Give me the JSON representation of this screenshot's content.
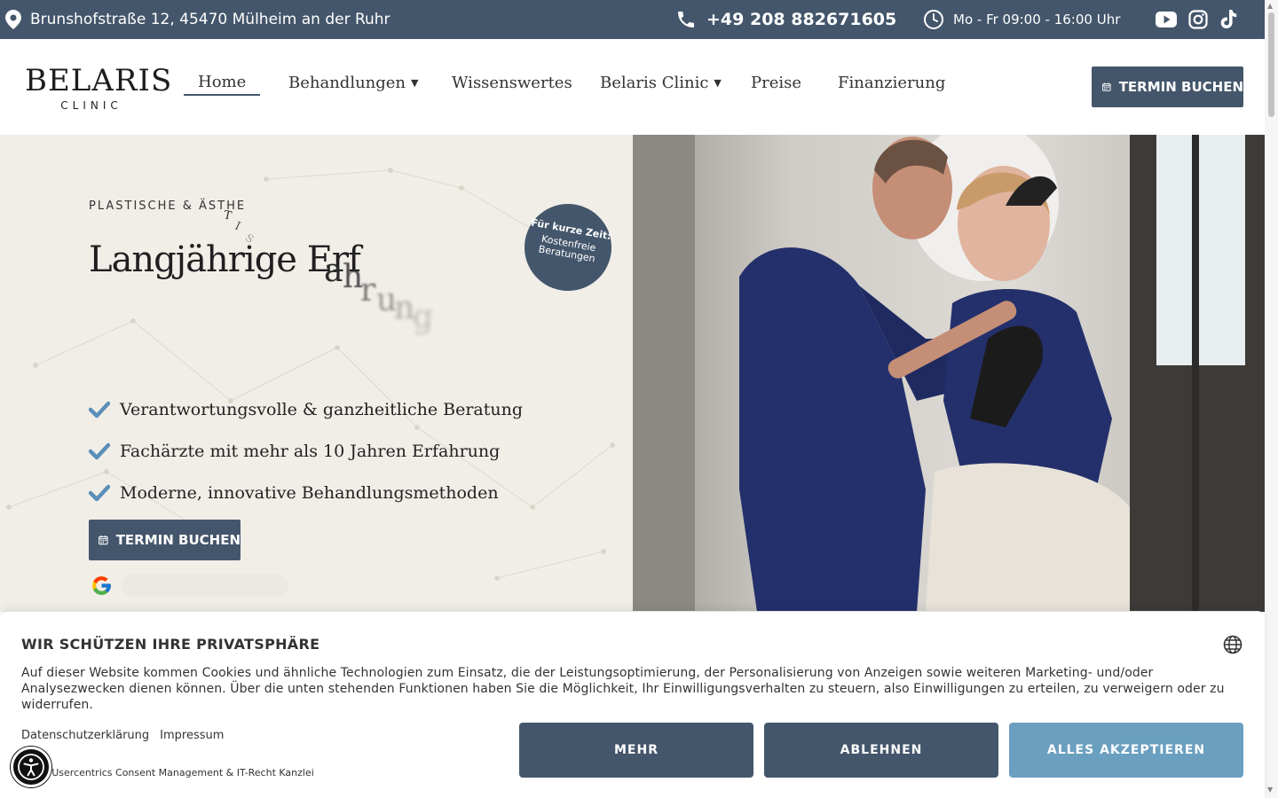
{
  "topbar": {
    "address": "Brunshofstraße 12, 45470 Mülheim an der Ruhr",
    "phone": "+49 208 882671605",
    "hours": "Mo - Fr 09:00 - 16:00 Uhr",
    "social_icons": [
      "youtube-icon",
      "instagram-icon",
      "tiktok-icon"
    ]
  },
  "logo": {
    "line1": "BELARIS",
    "line2": "CLINIC"
  },
  "nav": {
    "items": [
      {
        "label": "Home",
        "active": true
      },
      {
        "label": "Behandlungen",
        "dropdown": true
      },
      {
        "label": "Wissenswertes"
      },
      {
        "label": "Belaris Clinic",
        "dropdown": true
      },
      {
        "label": "Preise"
      },
      {
        "label": "Finanzierung"
      }
    ],
    "cta": "TERMIN BUCHEN"
  },
  "hero": {
    "eyebrow": "PLASTISCHE & ÄSTHE",
    "eyebrow_scatter": [
      "T",
      "I",
      "S"
    ],
    "headline": "Langjährige Erf",
    "headline_scatter": [
      "a",
      "h",
      "r",
      "u",
      "n",
      "g"
    ],
    "badge_line1": "Für kurze Zeit:",
    "badge_line2": "Kostenfreie Beratungen",
    "checks": [
      "Verantwortungsvolle & ganzheitliche Beratung",
      "Fachärzte mit mehr als 10 Jahren Erfahrung",
      "Moderne, innovative Behandlungsmethoden"
    ],
    "cta": "TERMIN BUCHEN",
    "review_icon": "google-icon"
  },
  "consent": {
    "title": "WIR SCHÜTZEN IHRE PRIVATSPHÄRE",
    "text": "Auf dieser Website kommen Cookies und ähnliche Technologien zum Einsatz, die der Leistungsoptimierung, der Personalisierung von Anzeigen sowie weiteren Marketing- und/oder Analysezwecken dienen können. Über die unten stehenden Funktionen haben Sie die Möglichkeit, Ihr Einwilligungsverhalten zu steuern, also Einwilligungen zu erteilen, zu verweigern oder zu widerrufen.",
    "link_privacy": "Datenschutzerklärung",
    "link_imprint": "Impressum",
    "powered": "ed by Usercentrics Consent Management & IT-Recht Kanzlei",
    "btn_more": "MEHR",
    "btn_decline": "ABLEHNEN",
    "btn_accept": "ALLES AKZEPTIEREN"
  },
  "colors": {
    "brand_dark": "#44566b",
    "accent_blue": "#6a9fc0",
    "check_blue": "#5b8fb9",
    "hero_bg": "#f1eee8"
  }
}
